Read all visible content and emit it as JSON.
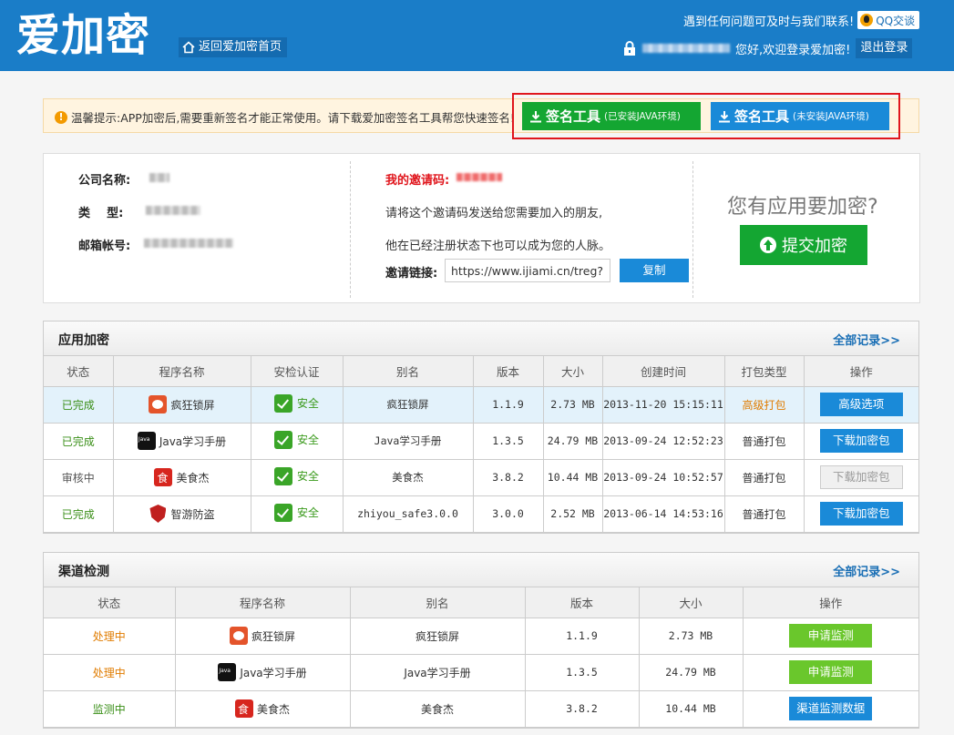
{
  "header": {
    "logo": "爱加密",
    "home_link": "返回爱加密首页",
    "help_text": "遇到任何问题可及时与我们联系!",
    "qq_label": "QQ交谈",
    "greeting": "您好,欢迎登录爱加密!",
    "logout": "退出登录"
  },
  "tip": {
    "text": "温馨提示:APP加密后,需要重新签名才能正常使用。请下载爱加密签名工具帮您快速签名!",
    "sign_java": {
      "label": "签名工具",
      "note": "(已安装JAVA环境)"
    },
    "sign_nojava": {
      "label": "签名工具",
      "note": "(未安装JAVA环境)"
    }
  },
  "profile": {
    "company_label": "公司名称:",
    "type_label": "类    型:",
    "email_label": "邮箱帐号:",
    "invite_label": "我的邀请码:",
    "invite_line1": "请将这个邀请码发送给您需要加入的朋友,",
    "invite_line2": "他在已经注册状态下也可以成为您的人脉。",
    "link_label": "邀请链接:",
    "link_value": "https://www.ijiami.cn/treg?reg",
    "copy": "复制",
    "cta_title": "您有应用要加密?",
    "cta_button": "提交加密"
  },
  "encrypt": {
    "title": "应用加密",
    "more": "全部记录>>",
    "columns": [
      "状态",
      "程序名称",
      "安检认证",
      "别名",
      "版本",
      "大小",
      "创建时间",
      "打包类型",
      "操作"
    ],
    "rows": [
      {
        "status": "已完成",
        "status_kind": "ok",
        "icon": "pig",
        "name": "疯狂锁屏",
        "cert": "安全",
        "alias": "疯狂锁屏",
        "version": "1.1.9",
        "size": "2.73 MB",
        "created": "2013-11-20 15:15:11",
        "pack": "高级打包",
        "pack_kind": "adv",
        "action": "高级选项",
        "action_kind": "blue"
      },
      {
        "status": "已完成",
        "status_kind": "ok",
        "icon": "java",
        "name": "Java学习手册",
        "cert": "安全",
        "alias": "Java学习手册",
        "version": "1.3.5",
        "size": "24.79 MB",
        "created": "2013-09-24 12:52:23",
        "pack": "普通打包",
        "pack_kind": "normal",
        "action": "下载加密包",
        "action_kind": "blue"
      },
      {
        "status": "审核中",
        "status_kind": "review",
        "icon": "food",
        "name": "美食杰",
        "cert": "安全",
        "alias": "美食杰",
        "version": "3.8.2",
        "size": "10.44 MB",
        "created": "2013-09-24 10:52:57",
        "pack": "普通打包",
        "pack_kind": "normal",
        "action": "下载加密包",
        "action_kind": "gray"
      },
      {
        "status": "已完成",
        "status_kind": "ok",
        "icon": "shield",
        "name": "智游防盗",
        "cert": "安全",
        "alias": "zhiyou_safe3.0.0",
        "version": "3.0.0",
        "size": "2.52 MB",
        "created": "2013-06-14 14:53:16",
        "pack": "普通打包",
        "pack_kind": "normal",
        "action": "下载加密包",
        "action_kind": "blue"
      }
    ]
  },
  "channel": {
    "title": "渠道检测",
    "more": "全部记录>>",
    "columns": [
      "状态",
      "程序名称",
      "别名",
      "版本",
      "大小",
      "操作"
    ],
    "rows": [
      {
        "status": "处理中",
        "status_kind": "proc",
        "icon": "pig",
        "name": "疯狂锁屏",
        "alias": "疯狂锁屏",
        "version": "1.1.9",
        "size": "2.73 MB",
        "action": "申请监测",
        "action_kind": "green"
      },
      {
        "status": "处理中",
        "status_kind": "proc",
        "icon": "java",
        "name": "Java学习手册",
        "alias": "Java学习手册",
        "version": "1.3.5",
        "size": "24.79 MB",
        "action": "申请监测",
        "action_kind": "green"
      },
      {
        "status": "监测中",
        "status_kind": "ok",
        "icon": "food",
        "name": "美食杰",
        "alias": "美食杰",
        "version": "3.8.2",
        "size": "10.44 MB",
        "action": "渠道监测数据",
        "action_kind": "blue"
      }
    ]
  }
}
